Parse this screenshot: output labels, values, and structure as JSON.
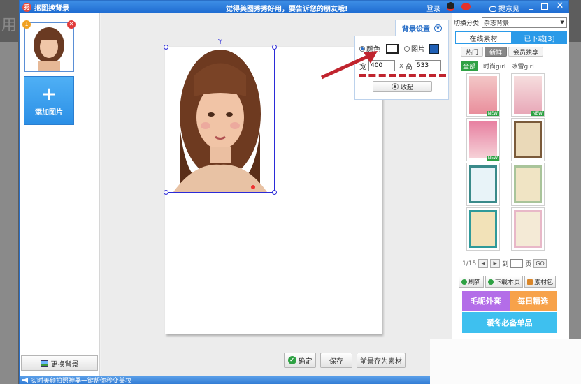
{
  "window": {
    "title": "抠图换背景",
    "slogan": "觉得美图秀秀好用，要告诉您的朋友哦!",
    "login": "登录",
    "feedback": "提意见"
  },
  "left_panel": {
    "thumb_number": "1",
    "add_label": "添加图片",
    "replace_bg_label": "更换背景"
  },
  "bg_settings": {
    "tab_label": "背景设置",
    "color_label": "颜色",
    "picture_label": "图片",
    "width_label": "宽",
    "width_value": "400",
    "height_label": "高",
    "height_value": "533",
    "times": "x",
    "collapse_label": "收起",
    "selected_color": "#ffffff"
  },
  "bottom_buttons": {
    "confirm": "确定",
    "save": "保存",
    "save_as_material": "前景存为素材"
  },
  "right_panel": {
    "switch_label": "切换分类",
    "switch_value": "杂志背景",
    "tab_online": "在线素材",
    "tab_downloaded": "已下载[3]",
    "filters": [
      "热门",
      "新鲜",
      "会员独享"
    ],
    "categories": [
      "全部",
      "时尚girl",
      "冰雪girl"
    ],
    "page": "1/15",
    "to_label": "到",
    "page_unit": "页",
    "go": "GO",
    "refresh": "刷新",
    "download_page": "下载本页",
    "material_pack": "素材包",
    "banner_left": "毛呢外套",
    "banner_right": "每日精选",
    "banner_bottom": "暖冬必备单品",
    "new_badge": "NEW"
  },
  "status_text": "实时美颜拍照神器一键帮你秒变美妆",
  "background_text": "用"
}
